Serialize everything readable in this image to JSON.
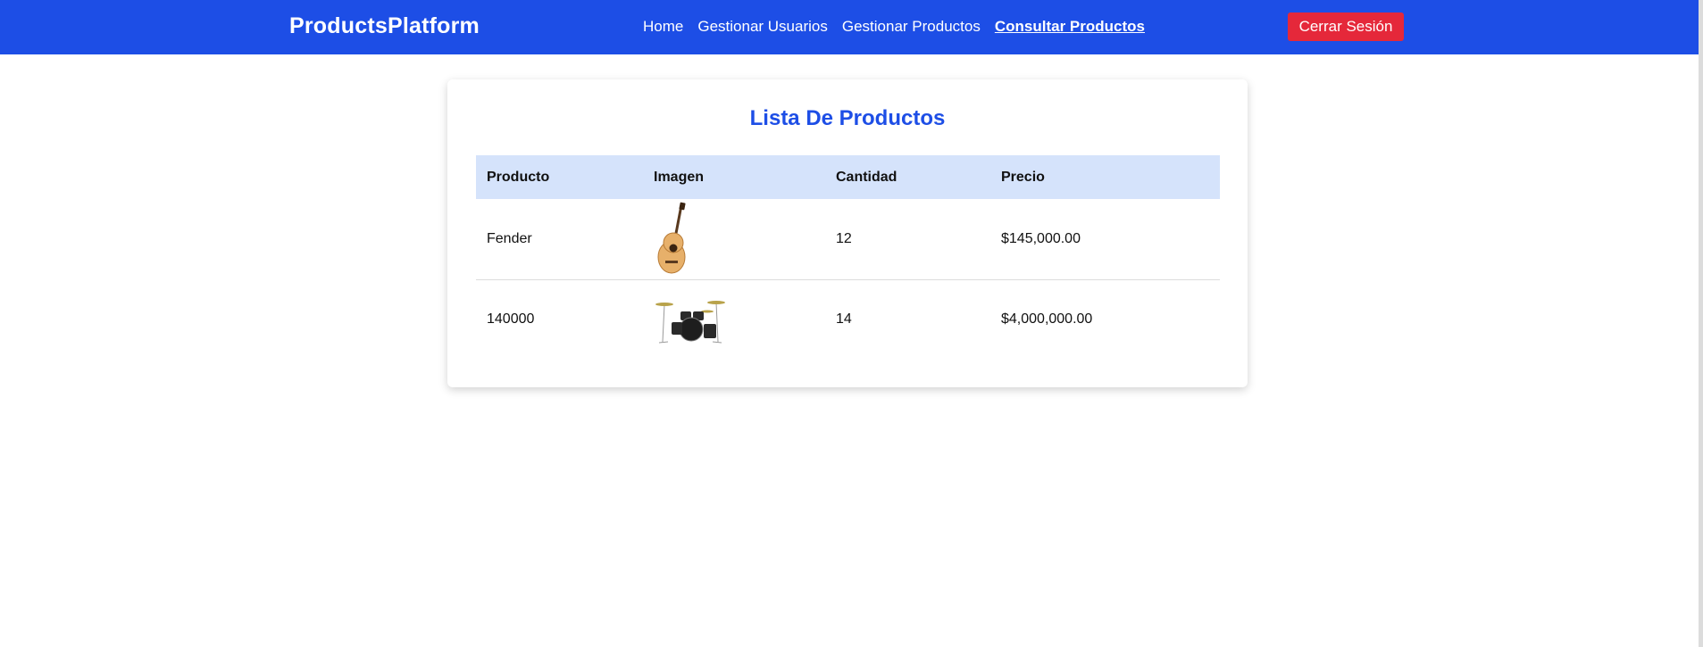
{
  "navbar": {
    "brand": "ProductsPlatform",
    "links": [
      "Home",
      "Gestionar Usuarios",
      "Gestionar Productos",
      "Consultar Productos"
    ],
    "active_link": "Consultar Productos",
    "logout_label": "Cerrar Sesión"
  },
  "main": {
    "title": "Lista De Productos",
    "table": {
      "headers": [
        "Producto",
        "Imagen",
        "Cantidad",
        "Precio"
      ],
      "rows": [
        {
          "producto": "Fender",
          "imagen": "guitar-image",
          "cantidad": "12",
          "precio": "$145,000.00"
        },
        {
          "producto": "140000",
          "imagen": "drum-kit-image",
          "cantidad": "14",
          "precio": "$4,000,000.00"
        }
      ]
    }
  },
  "colors": {
    "navbar_bg": "#1d4ee6",
    "accent": "#1d4ee6",
    "logout_bg": "#e5283a",
    "table_header_bg": "#d5e3fb"
  }
}
